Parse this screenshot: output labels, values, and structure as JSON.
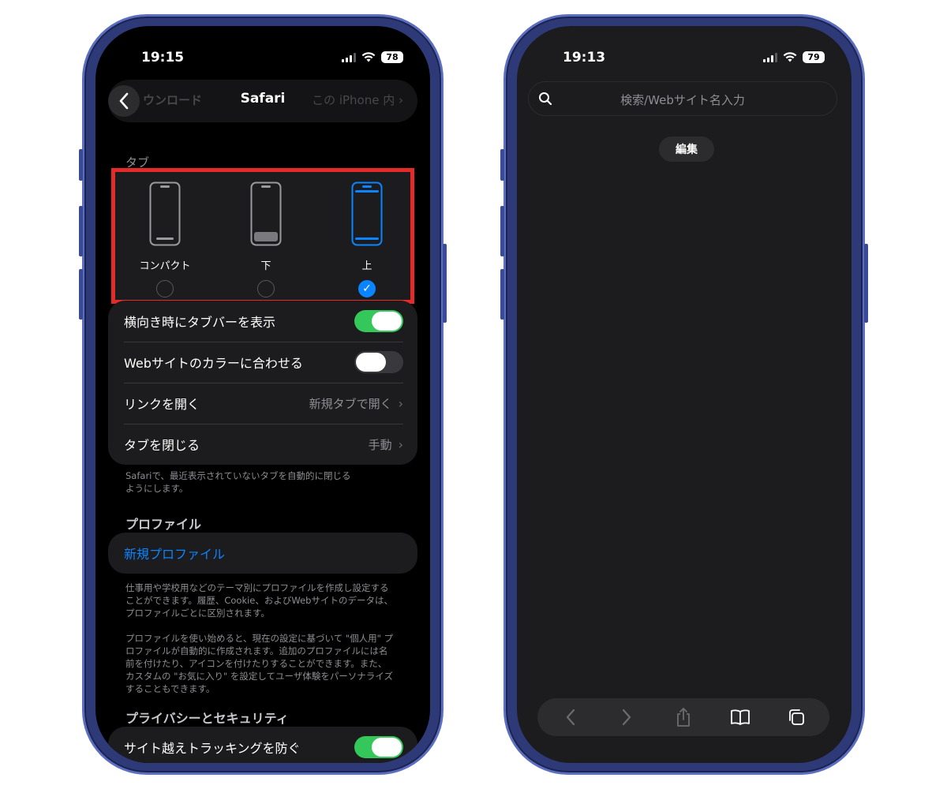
{
  "left_phone": {
    "status": {
      "time": "19:15",
      "battery": "78"
    },
    "nav": {
      "back_hint": "ウンロード",
      "title": "Safari",
      "right_hint": "この iPhone 内 ›"
    },
    "tabs_section": {
      "label": "タブ",
      "options": [
        {
          "label": "コンパクト",
          "selected": false
        },
        {
          "label": "下",
          "selected": false
        },
        {
          "label": "上",
          "selected": true
        }
      ]
    },
    "rows": [
      {
        "label": "横向き時にタブバーを表示",
        "toggle": true
      },
      {
        "label": "Webサイトのカラーに合わせる",
        "toggle": false
      },
      {
        "label": "リンクを開く",
        "value": "新規タブで開く"
      },
      {
        "label": "タブを閉じる",
        "value": "手動"
      }
    ],
    "tabs_footnote": "Safariで、最近表示されていないタブを自動的に閉じる\nようにします。",
    "profile_section": {
      "label": "プロファイル",
      "new_profile": "新規プロファイル",
      "footnote_1": "仕事用や学校用などのテーマ別にプロファイルを作成し設定する\nことができます。履歴、Cookie、およびWebサイトのデータは、\nプロファイルごとに区別されます。",
      "footnote_2": "プロファイルを使い始めると、現在の設定に基づいて \"個人用\" プ\nロファイルが自動的に作成されます。追加のプロファイルには名\n前を付けたり、アイコンを付けたりすることができます。また、\nカスタムの \"お気に入り\" を設定してユーザ体験をパーソナライズ\nすることもできます。"
    },
    "privacy_section": {
      "label": "プライバシーとセキュリティ",
      "row": {
        "label": "サイト越えトラッキングを防ぐ",
        "toggle": true
      }
    }
  },
  "right_phone": {
    "status": {
      "time": "19:13",
      "battery": "79"
    },
    "search": {
      "placeholder": "検索/Webサイト名入力"
    },
    "edit_button": "編集",
    "toolbar": {
      "icons": [
        "back-icon",
        "forward-icon",
        "share-icon",
        "bookmarks-icon",
        "tabs-icon"
      ]
    }
  },
  "colors": {
    "accent_blue": "#0a84ff",
    "toggle_on": "#34c759",
    "highlight_border": "#e52a2a",
    "frame": "#2e3a78"
  }
}
